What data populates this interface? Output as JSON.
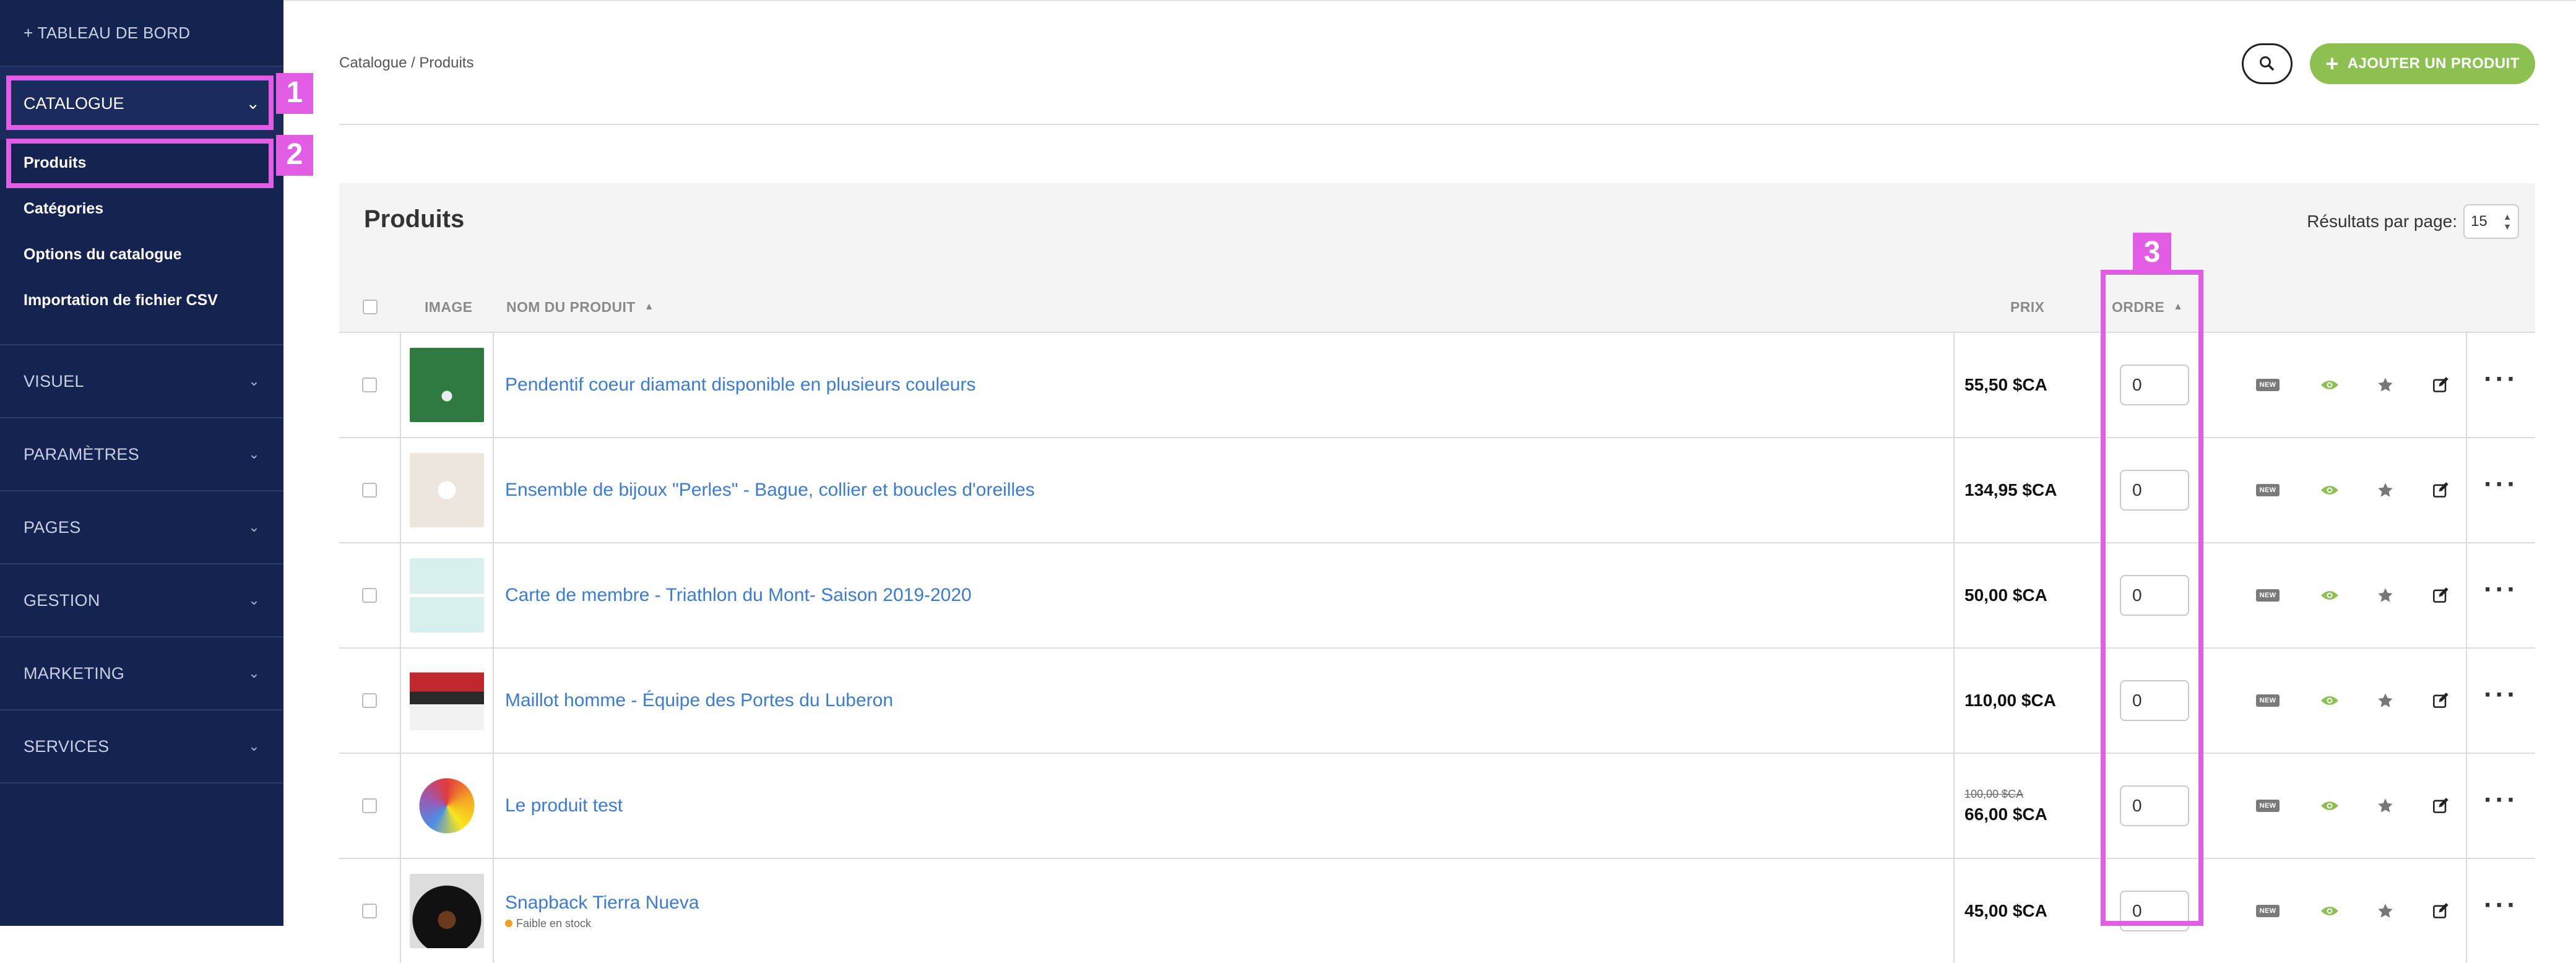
{
  "sidebar": {
    "dashboard": "+ TABLEAU DE BORD",
    "catalogue": "CATALOGUE",
    "sub_items": [
      "Produits",
      "Catégories",
      "Options du catalogue",
      "Importation de fichier CSV"
    ],
    "sections": [
      "VISUEL",
      "PARAMÈTRES",
      "PAGES",
      "GESTION",
      "MARKETING",
      "SERVICES"
    ]
  },
  "annotations": [
    "1",
    "2",
    "3"
  ],
  "breadcrumb": "Catalogue / Produits",
  "add_button": "AJOUTER UN PRODUIT",
  "panel": {
    "title": "Produits",
    "results_per_page_label": "Résultats par page:",
    "results_per_page_value": "15"
  },
  "table": {
    "headers": {
      "image": "IMAGE",
      "name": "NOM DU PRODUIT",
      "price": "PRIX",
      "order": "ORDRE"
    },
    "new_badge": "NEW",
    "rows": [
      {
        "name": "Pendentif coeur diamant disponible en plusieurs couleurs",
        "price": "55,50 $CA",
        "old_price": "",
        "stock": "",
        "order": "0"
      },
      {
        "name": "Ensemble de bijoux \"Perles\" - Bague, collier et boucles d'oreilles",
        "price": "134,95 $CA",
        "old_price": "",
        "stock": "",
        "order": "0"
      },
      {
        "name": "Carte de membre - Triathlon du Mont- Saison 2019-2020",
        "price": "50,00 $CA",
        "old_price": "",
        "stock": "",
        "order": "0"
      },
      {
        "name": "Maillot homme - Équipe des Portes du Luberon",
        "price": "110,00 $CA",
        "old_price": "",
        "stock": "",
        "order": "0"
      },
      {
        "name": "Le produit test",
        "price": "66,00 $CA",
        "old_price": "100,00 $CA",
        "stock": "",
        "order": "0"
      },
      {
        "name": "Snapback Tierra Nueva",
        "price": "45,00 $CA",
        "old_price": "",
        "stock": "Faible en stock",
        "order": "0"
      }
    ]
  },
  "colors": {
    "sidebar_bg": "#142350",
    "accent_green": "#8cc152",
    "link_blue": "#3a7bd5",
    "annotation_magenta": "#e25ce5"
  }
}
